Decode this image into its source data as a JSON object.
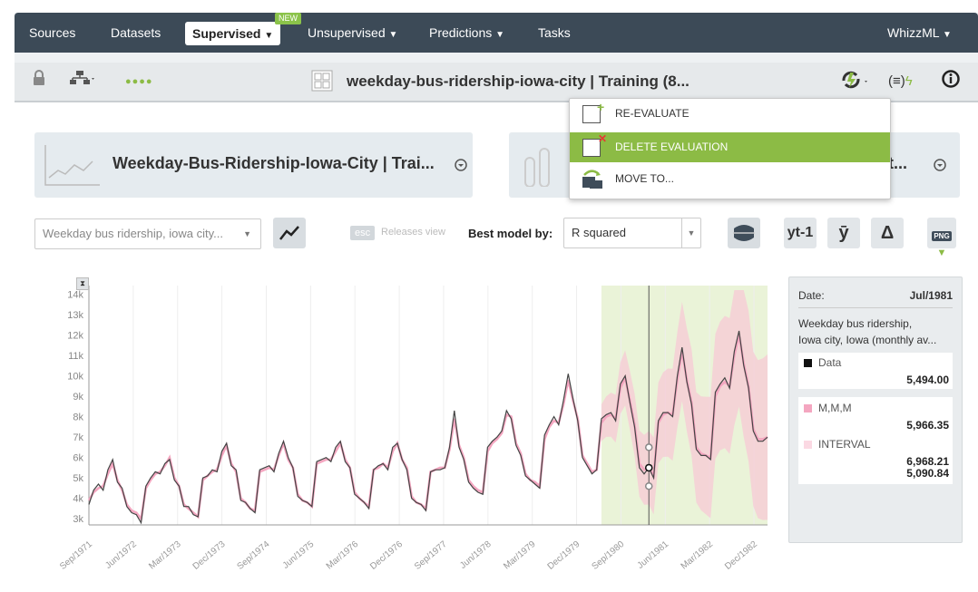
{
  "nav": {
    "items": [
      "Sources",
      "Datasets",
      "Supervised",
      "Unsupervised",
      "Predictions",
      "Tasks"
    ],
    "new_badge": "NEW",
    "right": "WhizzML"
  },
  "toolbar": {
    "title": "weekday-bus-ridership-iowa-city | Training (8...",
    "dots": "●●●●",
    "formula_icon": "(≡)"
  },
  "cards": {
    "left_title": "Weekday-Bus-Ridership-Iowa-City | Trai...",
    "right_title": "t..."
  },
  "menu": {
    "items": [
      {
        "label": "RE-EVALUATE"
      },
      {
        "label": "DELETE EVALUATION"
      },
      {
        "label": "MOVE TO..."
      }
    ]
  },
  "controls": {
    "objective_select": "Weekday bus ridership, iowa city...",
    "esc_label": "esc",
    "releases_view": "Releases view",
    "best_model_label": "Best model by:",
    "best_model_value": "R squared",
    "yt1_label": "yt-1",
    "ybar_label": "ȳ",
    "delta_label": "Δ",
    "png_label": "PNG"
  },
  "panel": {
    "date_label": "Date:",
    "date_value": "Jul/1981",
    "field_desc_1": "Weekday bus ridership,",
    "field_desc_2": "Iowa city, Iowa (monthly av...",
    "data_label": "Data",
    "data_value": "5,494.00",
    "model_label": "M,M,M",
    "model_value": "5,966.35",
    "interval_label": "INTERVAL",
    "interval_high": "6,968.21",
    "interval_low": "5,090.84"
  },
  "colors": {
    "nav_bg": "#3c4a57",
    "highlight": "#8cbb45",
    "data_line": "#444444",
    "model_line": "#f4a6c0",
    "interval": "#f7c9d6",
    "test_region": "#eaf3d8"
  },
  "chart_data": {
    "type": "line",
    "y_ticks": [
      "3k",
      "4k",
      "5k",
      "6k",
      "7k",
      "8k",
      "9k",
      "10k",
      "11k",
      "12k",
      "13k",
      "14k"
    ],
    "ylim": [
      2700,
      14200
    ],
    "x_ticks": [
      "Sep/1971",
      "Jun/1972",
      "Mar/1973",
      "Dec/1973",
      "Sep/1974",
      "Jun/1975",
      "Mar/1976",
      "Dec/1976",
      "Sep/1977",
      "Jun/1978",
      "Mar/1979",
      "Dec/1979",
      "Sep/1980",
      "Jun/1981",
      "Mar/1982",
      "Dec/1982"
    ],
    "series": [
      {
        "name": "Data",
        "values": [
          3700,
          4400,
          4700,
          4400,
          5400,
          5900,
          4800,
          4500,
          3600,
          3300,
          3200,
          2800,
          4600,
          5000,
          5300,
          5200,
          5700,
          5900,
          4900,
          4600,
          3600,
          3600,
          3200,
          3100,
          5000,
          5100,
          5400,
          5300,
          6300,
          6700,
          5600,
          5400,
          3900,
          3800,
          3500,
          3300,
          5400,
          5500,
          5600,
          5300,
          6200,
          6800,
          6000,
          5500,
          4100,
          3900,
          3800,
          3600,
          5800,
          5900,
          6000,
          5800,
          6500,
          6800,
          5800,
          5500,
          4200,
          4000,
          3800,
          3500,
          5400,
          5600,
          5700,
          5400,
          6500,
          6700,
          5900,
          5400,
          4000,
          3800,
          3700,
          3400,
          5300,
          5400,
          5400,
          5500,
          6500,
          8300,
          6500,
          5900,
          4800,
          4500,
          4300,
          4200,
          6500,
          6800,
          7000,
          7300,
          8300,
          7900,
          6600,
          6100,
          5100,
          4900,
          4700,
          4500,
          7100,
          7600,
          8000,
          7600,
          8800,
          10100,
          8900,
          7800,
          6000,
          5600,
          5200,
          5400,
          7900,
          8100,
          8200,
          7800,
          9600,
          10000,
          8700,
          7500,
          5500,
          5200,
          5500,
          5000,
          7800,
          8200,
          8200,
          8000,
          10000,
          11400,
          9700,
          8600,
          6400,
          6100,
          6100,
          5900,
          9200,
          9600,
          9900,
          9400,
          11200,
          12200,
          10500,
          9400,
          7300,
          6800,
          6800,
          7000
        ]
      },
      {
        "name": "M,M,M",
        "values": [
          3900,
          4300,
          4500,
          4600,
          5200,
          5700,
          4900,
          4400,
          3700,
          3400,
          3300,
          3000,
          4500,
          4900,
          5200,
          5300,
          5600,
          6000,
          5000,
          4600,
          3700,
          3500,
          3300,
          3100,
          4900,
          5100,
          5300,
          5400,
          6100,
          6600,
          5700,
          5300,
          4000,
          3800,
          3500,
          3400,
          5300,
          5400,
          5500,
          5400,
          6100,
          6700,
          5900,
          5500,
          4200,
          3900,
          3800,
          3600,
          5700,
          5800,
          5900,
          5900,
          6300,
          6700,
          5900,
          5500,
          4300,
          4000,
          3800,
          3600,
          5400,
          5500,
          5700,
          5500,
          6300,
          6700,
          5900,
          5500,
          4100,
          3800,
          3700,
          3500,
          5300,
          5400,
          5500,
          5500,
          6400,
          7900,
          6600,
          6000,
          4900,
          4600,
          4400,
          4300,
          6300,
          6700,
          6900,
          7200,
          8100,
          8000,
          6700,
          6200,
          5200,
          4900,
          4800,
          4600,
          6900,
          7500,
          7800,
          7700,
          8600,
          9800,
          8800,
          7900,
          6100,
          5700,
          5300,
          5400,
          7700,
          8000,
          8100,
          7900,
          9400,
          9900,
          8800,
          7600,
          5700,
          5400,
          5500,
          5100,
          7700,
          8100,
          8200,
          8100,
          9800,
          11200,
          9800,
          8700,
          6500,
          6200,
          6100,
          6000,
          9000,
          9500,
          9700,
          9500,
          11000,
          12000,
          10600,
          9500,
          7400,
          6900,
          6900,
          7000
        ]
      }
    ],
    "test_start_index": 108,
    "highlight_index": 118
  }
}
